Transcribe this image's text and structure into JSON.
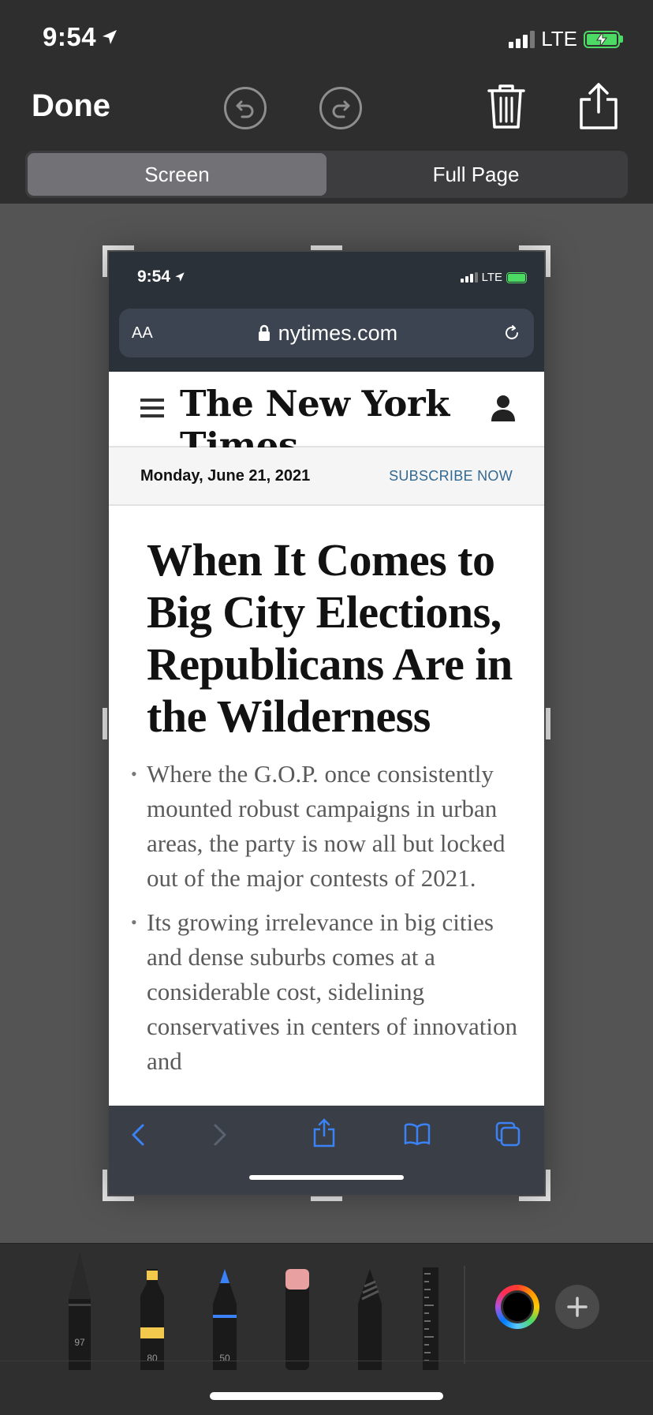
{
  "status_bar": {
    "time": "9:54",
    "network": "LTE"
  },
  "toolbar": {
    "done_label": "Done"
  },
  "segments": [
    {
      "label": "Screen",
      "active": true
    },
    {
      "label": "Full Page",
      "active": false
    }
  ],
  "preview": {
    "status_time": "9:54",
    "status_network": "LTE",
    "url_aa": "AA",
    "url": "nytimes.com",
    "masthead": "The New York Times",
    "date": "Monday, June 21, 2021",
    "subscribe": "SUBSCRIBE NOW",
    "headline": "When It Comes to Big City Elections, Republicans Are in the Wilderness",
    "bullets": [
      "Where the G.O.P. once consistently mounted robust campaigns in urban areas, the party is now all but locked out of the major contests of 2021.",
      "Its growing irrelevance in big cities and dense suburbs comes at a considerable cost, sidelining conservatives in centers of innovation and"
    ]
  },
  "tools": {
    "pen_width": "97",
    "marker_width": "80",
    "pencil_width": "50"
  },
  "colors": {
    "accent_green": "#4cd964",
    "link_blue": "#326891",
    "safari_blue": "#3b82f6"
  }
}
